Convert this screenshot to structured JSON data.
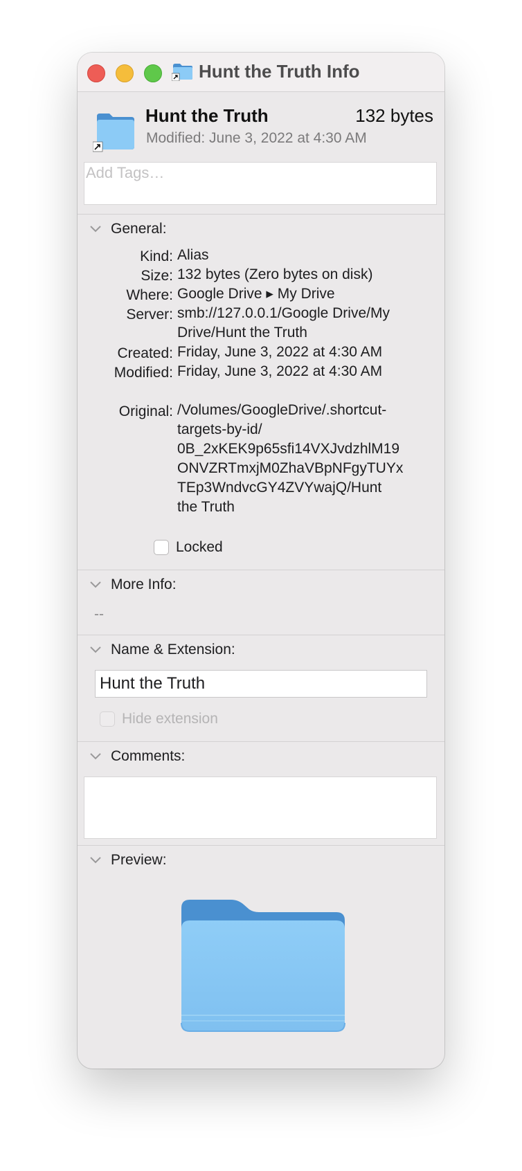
{
  "window": {
    "title": "Hunt the Truth Info"
  },
  "header": {
    "name": "Hunt the Truth",
    "size": "132 bytes",
    "modified": "Modified: June 3, 2022 at 4:30 AM",
    "tags_placeholder": "Add Tags…"
  },
  "general": {
    "title": "General:",
    "kind_label": "Kind:",
    "kind_value": "Alias",
    "size_label": "Size:",
    "size_value": "132 bytes (Zero bytes on disk)",
    "where_label": "Where:",
    "where_value": "Google Drive ▸ My Drive",
    "server_label": "Server:",
    "server_value_lines": [
      "smb://127.0.0.1/Google Drive/My",
      "Drive/Hunt the Truth"
    ],
    "created_label": "Created:",
    "created_value": "Friday, June 3, 2022 at 4:30 AM",
    "modified_label": "Modified:",
    "modified_value": "Friday, June 3, 2022 at 4:30 AM",
    "original_label": "Original:",
    "original_value_lines": [
      "/Volumes/GoogleDrive/.shortcut-",
      "targets-by-id/",
      "0B_2xKEK9p65sfi14VXJvdzhlM19",
      "ONVZRTmxjM0ZhaVBpNFgyTUYx",
      "TEp3WndvcGY4ZVYwajQ/Hunt",
      "the Truth"
    ],
    "locked_label": "Locked",
    "locked": false
  },
  "more_info": {
    "title": "More Info:",
    "value": "--"
  },
  "name_extension": {
    "title": "Name & Extension:",
    "name_value": "Hunt the Truth",
    "hide_extension_label": "Hide extension",
    "hide_extension": false
  },
  "comments": {
    "title": "Comments:",
    "value": ""
  },
  "preview": {
    "title": "Preview:"
  },
  "colors": {
    "close": "#ee5d56",
    "minimize": "#f5bd3b",
    "maximize": "#5fc84a",
    "folder_front": "#8ccbf6",
    "folder_back": "#4a90d0"
  }
}
